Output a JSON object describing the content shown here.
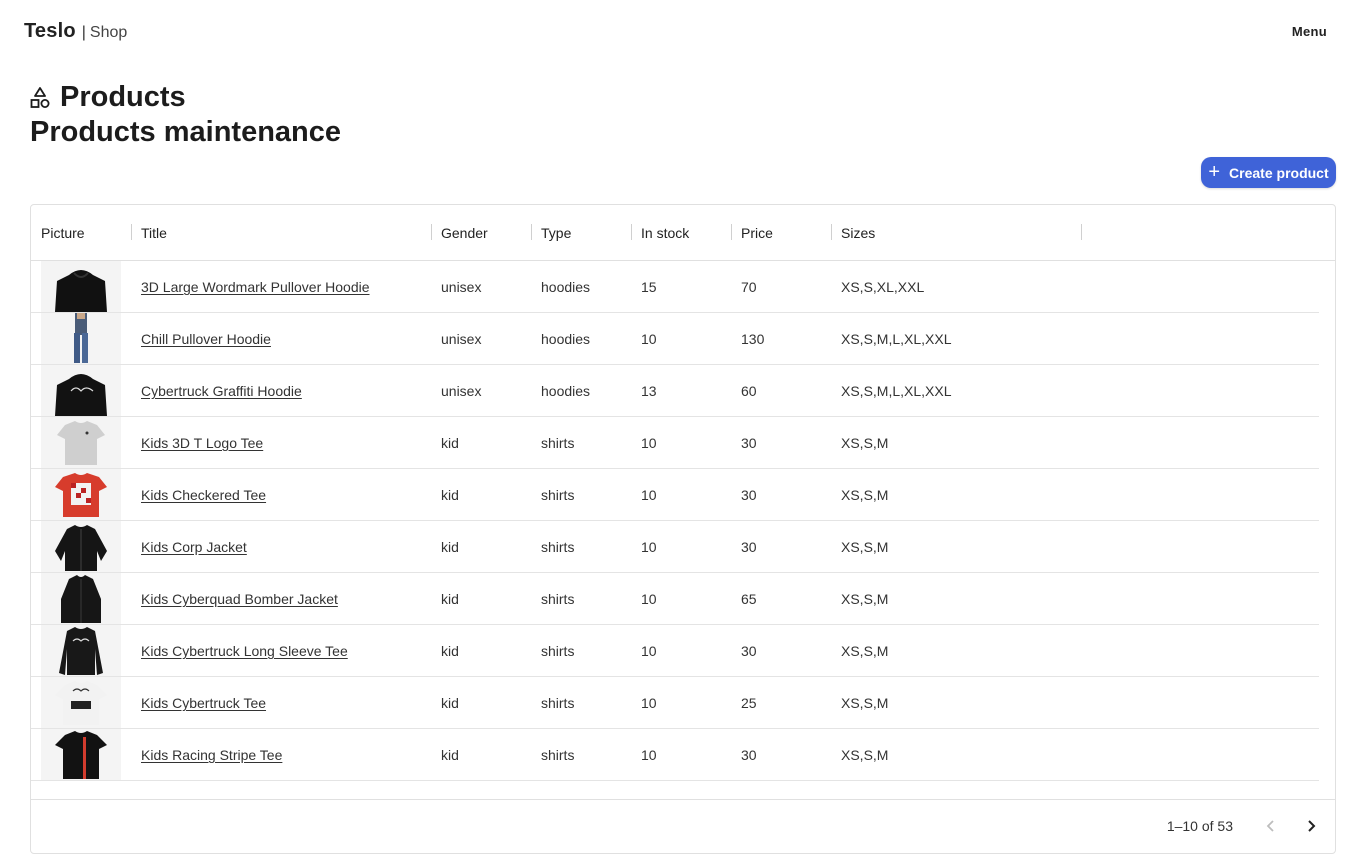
{
  "navbar": {
    "brand": "Teslo",
    "separator": "|",
    "section": "Shop",
    "menu_label": "Menu"
  },
  "page": {
    "title": "Products",
    "subtitle": "Products maintenance",
    "create_button": "Create product"
  },
  "table": {
    "columns": [
      "Picture",
      "Title",
      "Gender",
      "Type",
      "In stock",
      "Price",
      "Sizes"
    ],
    "rows": [
      {
        "image": "black-hoodie",
        "title": "3D Large Wordmark Pullover Hoodie",
        "gender": "unisex",
        "type": "hoodies",
        "in_stock": "15",
        "price": "70",
        "sizes": "XS,S,XL,XXL"
      },
      {
        "image": "model-jeans",
        "title": "Chill Pullover Hoodie",
        "gender": "unisex",
        "type": "hoodies",
        "in_stock": "10",
        "price": "130",
        "sizes": "XS,S,M,L,XL,XXL"
      },
      {
        "image": "black-graphic-hoodie",
        "title": "Cybertruck Graffiti Hoodie",
        "gender": "unisex",
        "type": "hoodies",
        "in_stock": "13",
        "price": "60",
        "sizes": "XS,S,M,L,XL,XXL"
      },
      {
        "image": "grey-tee",
        "title": "Kids 3D T Logo Tee",
        "gender": "kid",
        "type": "shirts",
        "in_stock": "10",
        "price": "30",
        "sizes": "XS,S,M"
      },
      {
        "image": "red-checkered-tee",
        "title": "Kids Checkered Tee",
        "gender": "kid",
        "type": "shirts",
        "in_stock": "10",
        "price": "30",
        "sizes": "XS,S,M"
      },
      {
        "image": "black-jacket",
        "title": "Kids Corp Jacket",
        "gender": "kid",
        "type": "shirts",
        "in_stock": "10",
        "price": "30",
        "sizes": "XS,S,M"
      },
      {
        "image": "black-bomber",
        "title": "Kids Cyberquad Bomber Jacket",
        "gender": "kid",
        "type": "shirts",
        "in_stock": "10",
        "price": "65",
        "sizes": "XS,S,M"
      },
      {
        "image": "black-long-sleeve",
        "title": "Kids Cybertruck Long Sleeve Tee",
        "gender": "kid",
        "type": "shirts",
        "in_stock": "10",
        "price": "30",
        "sizes": "XS,S,M"
      },
      {
        "image": "white-graphic-tee",
        "title": "Kids Cybertruck Tee",
        "gender": "kid",
        "type": "shirts",
        "in_stock": "10",
        "price": "25",
        "sizes": "XS,S,M"
      },
      {
        "image": "black-stripe-tee",
        "title": "Kids Racing Stripe Tee",
        "gender": "kid",
        "type": "shirts",
        "in_stock": "10",
        "price": "30",
        "sizes": "XS,S,M"
      }
    ]
  },
  "pagination": {
    "range_text": "1–10 of 53",
    "prev_icon": "chevron-left-icon",
    "next_icon": "chevron-right-icon"
  },
  "colors": {
    "accent": "#3f63d8",
    "border": "#e0e0e0",
    "text": "#333333"
  }
}
